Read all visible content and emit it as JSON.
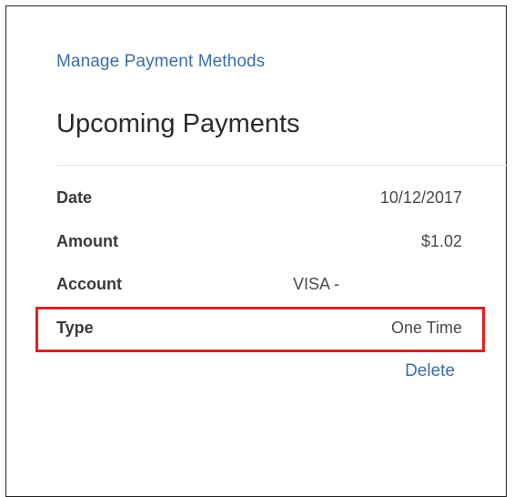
{
  "links": {
    "manage_payment_methods": "Manage Payment Methods",
    "delete": "Delete"
  },
  "page": {
    "title": "Upcoming Payments"
  },
  "payment": {
    "rows": [
      {
        "label": "Date",
        "value": "10/12/2017"
      },
      {
        "label": "Amount",
        "value": "$1.02"
      },
      {
        "label": "Account",
        "value": "VISA -"
      },
      {
        "label": "Type",
        "value": "One Time"
      }
    ]
  },
  "colors": {
    "link": "#3a6fa8",
    "highlight_border": "#e02020",
    "title": "#2b2b2b"
  }
}
